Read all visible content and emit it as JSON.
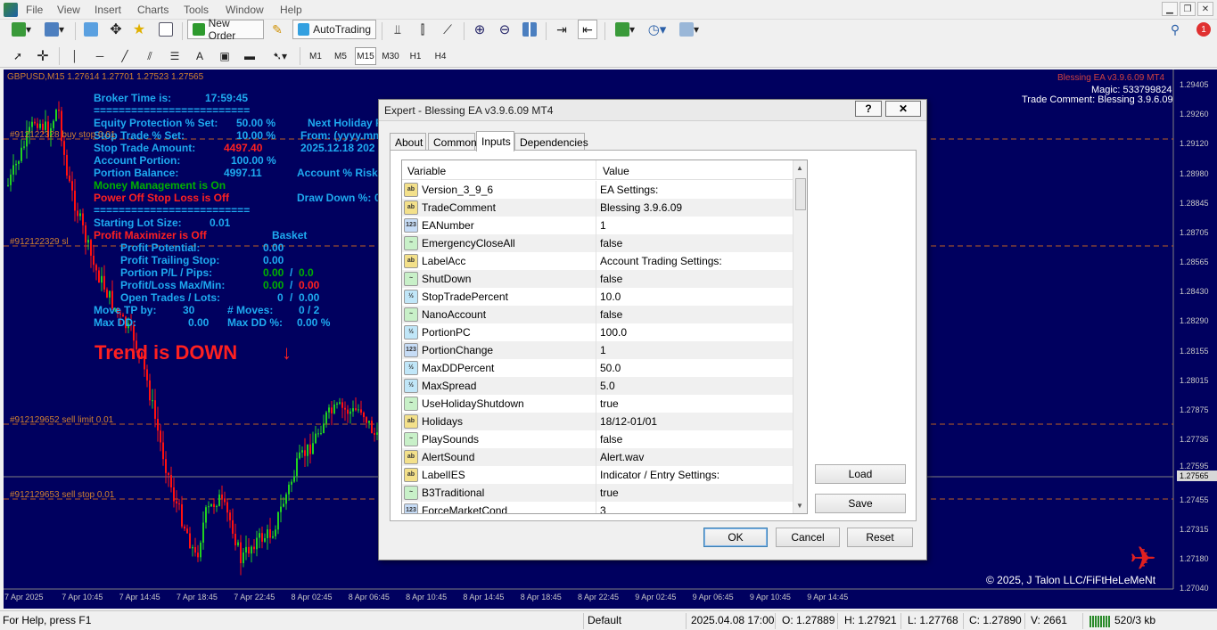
{
  "menu": {
    "items": [
      "File",
      "View",
      "Insert",
      "Charts",
      "Tools",
      "Window",
      "Help"
    ]
  },
  "toolbar": {
    "new_order": "New Order",
    "autotrading": "AutoTrading",
    "timeframes": [
      "M1",
      "M5",
      "M15",
      "M30",
      "H1",
      "H4"
    ],
    "active_timeframe": "M15",
    "notification_count": "1"
  },
  "chart": {
    "header": "GBPUSD,M15  1.27614 1.27701 1.27523 1.27565",
    "ea_name": "Blessing EA  v3.9.6.09 MT4",
    "magic": "Magic: 533799824",
    "trade_comment": "Trade Comment: Blessing 3.9.6.09",
    "copyright": "© 2025, J Talon LLC/FiFtHeLeMeNt",
    "trend_text": "Trend is DOWN",
    "trend_arrow": "↓",
    "overlay": {
      "broker_time_label": "Broker Time is:",
      "broker_time": "17:59:45",
      "sep1": "=========================",
      "equity_protection_label": "Equity Protection % Set:",
      "equity_protection": "50.00 %",
      "next_holiday": "Next Holiday P",
      "stop_trade_label": "Stop Trade % Set:",
      "stop_trade": "10.00 %",
      "from_label": "From: (yyyy.mm",
      "stop_amount_label": "Stop Trade Amount:",
      "stop_amount": "4497.40",
      "holiday_date": "2025.12.18  202",
      "account_portion_label": "Account Portion:",
      "account_portion": "100.00 %",
      "portion_balance_label": "Portion Balance:",
      "portion_balance": "4997.11",
      "account_risk": "Account % Risked",
      "money_mgmt": "Money Management is On",
      "power_off": "Power Off Stop Loss is Off",
      "drawdown": "Draw Down %:",
      "drawdown_value": "0",
      "sep2": "=========================",
      "starting_lot_label": "Starting Lot Size:",
      "starting_lot": "0.01",
      "profit_max": "Profit Maximizer is Off",
      "basket": "Basket",
      "profit_potential_label": "Profit Potential:",
      "profit_potential": "0.00",
      "profit_trailing_label": "Profit Trailing Stop:",
      "profit_trailing": "0.00",
      "portion_pl_label": "Portion P/L / Pips:",
      "portion_pl_a": "0.00",
      "portion_pl_sep": "/",
      "portion_pl_b": "0.0",
      "pl_maxmin_label": "Profit/Loss Max/Min:",
      "pl_max": "0.00",
      "pl_min": "0.00",
      "open_trades_label": "Open Trades / Lots:",
      "open_trades": "0",
      "open_lots": "0.00",
      "move_tp_label": "Move TP by:",
      "move_tp": "30",
      "moves_label": "# Moves:",
      "moves": "0  /  2",
      "max_dd_label": "Max DD:",
      "max_dd": "0.00",
      "max_dd_pct_label": "Max DD %:",
      "max_dd_pct": "0.00 %"
    },
    "hlines": [
      {
        "label": "#912122328 buy stop 0.01"
      },
      {
        "label": "#912122329 sl"
      },
      {
        "label": "#912129652 sell limit 0.01"
      },
      {
        "label": "#912129653 sell stop 0.01"
      }
    ],
    "price_axis": [
      "1.29405",
      "1.29260",
      "1.29120",
      "1.28980",
      "1.28845",
      "1.28705",
      "1.28565",
      "1.28430",
      "1.28290",
      "1.28155",
      "1.28015",
      "1.27875",
      "1.27735",
      "1.27595",
      "1.27565",
      "1.27455",
      "1.27315",
      "1.27180",
      "1.27040"
    ],
    "current_price": "1.27565",
    "time_axis": [
      "7 Apr 2025",
      "7 Apr 10:45",
      "7 Apr 14:45",
      "7 Apr 18:45",
      "7 Apr 22:45",
      "8 Apr 02:45",
      "8 Apr 06:45",
      "8 Apr 10:45",
      "8 Apr 14:45",
      "8 Apr 18:45",
      "8 Apr 22:45",
      "9 Apr 02:45",
      "9 Apr 06:45",
      "9 Apr 10:45",
      "9 Apr 14:45"
    ]
  },
  "dialog": {
    "title": "Expert - Blessing EA v3.9.6.09 MT4",
    "help": "?",
    "close": "✕",
    "tabs": [
      "About",
      "Common",
      "Inputs",
      "Dependencies"
    ],
    "active_tab": "Inputs",
    "col_variable": "Variable",
    "col_value": "Value",
    "rows": [
      {
        "icon": "ab",
        "name": "Version_3_9_6",
        "value": "EA Settings:"
      },
      {
        "icon": "ab",
        "name": "TradeComment",
        "value": "Blessing 3.9.6.09"
      },
      {
        "icon": "123",
        "name": "EANumber",
        "value": "1"
      },
      {
        "icon": "bool",
        "name": "EmergencyCloseAll",
        "value": "false"
      },
      {
        "icon": "ab",
        "name": "LabelAcc",
        "value": "Account Trading Settings:"
      },
      {
        "icon": "bool",
        "name": "ShutDown",
        "value": "false"
      },
      {
        "icon": "v2",
        "name": "StopTradePercent",
        "value": "10.0"
      },
      {
        "icon": "bool",
        "name": "NanoAccount",
        "value": "false"
      },
      {
        "icon": "v2",
        "name": "PortionPC",
        "value": "100.0"
      },
      {
        "icon": "123",
        "name": "PortionChange",
        "value": "1"
      },
      {
        "icon": "v2",
        "name": "MaxDDPercent",
        "value": "50.0"
      },
      {
        "icon": "v2",
        "name": "MaxSpread",
        "value": "5.0"
      },
      {
        "icon": "bool",
        "name": "UseHolidayShutdown",
        "value": "true"
      },
      {
        "icon": "ab",
        "name": "Holidays",
        "value": "18/12-01/01"
      },
      {
        "icon": "bool",
        "name": "PlaySounds",
        "value": "false"
      },
      {
        "icon": "ab",
        "name": "AlertSound",
        "value": "Alert.wav"
      },
      {
        "icon": "ab",
        "name": "LabelIES",
        "value": "Indicator / Entry Settings:"
      },
      {
        "icon": "bool",
        "name": "B3Traditional",
        "value": "true"
      },
      {
        "icon": "123",
        "name": "ForceMarketCond",
        "value": "3"
      }
    ],
    "load": "Load",
    "save": "Save",
    "ok": "OK",
    "cancel": "Cancel",
    "reset": "Reset"
  },
  "status": {
    "help": "For Help, press F1",
    "profile": "Default",
    "datetime": "2025.04.08 17:00",
    "open": "O: 1.27889",
    "high": "H: 1.27921",
    "low": "L: 1.27768",
    "close": "C: 1.27890",
    "volume": "V: 2661",
    "traffic": "520/3 kb"
  }
}
